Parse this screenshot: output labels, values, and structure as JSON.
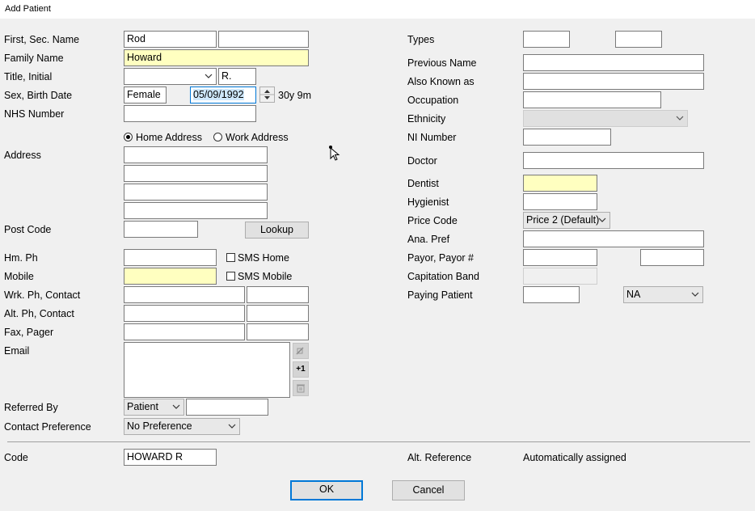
{
  "window": {
    "title": "Add Patient"
  },
  "left": {
    "first_sec_name_label": "First, Sec. Name",
    "first_name": "Rod",
    "second_name": "",
    "family_name_label": "Family Name",
    "family_name": "Howard",
    "title_initial_label": "Title, Initial",
    "title": "",
    "initial": "R.",
    "sex_birth_label": "Sex, Birth Date",
    "sex": "Female",
    "birth_date": "05/09/1992",
    "age": "30y 9m",
    "nhs_label": "NHS Number",
    "nhs_number": "",
    "home_address_label": "Home Address",
    "work_address_label": "Work Address",
    "address_label": "Address",
    "address_lines": [
      "",
      "",
      "",
      ""
    ],
    "post_code_label": "Post Code",
    "post_code": "",
    "lookup_button": "Lookup",
    "hm_ph_label": "Hm. Ph",
    "hm_ph": "",
    "sms_home_label": "SMS Home",
    "mobile_label": "Mobile",
    "mobile": "",
    "sms_mobile_label": "SMS Mobile",
    "wrk_ph_label": "Wrk. Ph, Contact",
    "alt_ph_label": "Alt. Ph, Contact",
    "fax_pager_label": "Fax, Pager",
    "email_label": "Email",
    "email_plus_one": "+1",
    "referred_by_label": "Referred By",
    "referred_by": "Patient",
    "contact_pref_label": "Contact Preference",
    "contact_pref": "No Preference",
    "code_label": "Code",
    "code": "HOWARD R"
  },
  "right": {
    "types_label": "Types",
    "previous_name_label": "Previous Name",
    "aka_label": "Also Known as",
    "occupation_label": "Occupation",
    "ethnicity_label": "Ethnicity",
    "ni_label": "NI Number",
    "doctor_label": "Doctor",
    "dentist_label": "Dentist",
    "hygienist_label": "Hygienist",
    "price_code_label": "Price Code",
    "price_code": "Price 2 (Default)",
    "ana_pref_label": "Ana. Pref",
    "payor_label": "Payor, Payor #",
    "capitation_label": "Capitation Band",
    "paying_patient_label": "Paying Patient",
    "paying_patient_option": "NA",
    "alt_reference_label": "Alt. Reference",
    "alt_reference_value": "Automatically assigned"
  },
  "footer": {
    "ok": "OK",
    "cancel": "Cancel"
  }
}
